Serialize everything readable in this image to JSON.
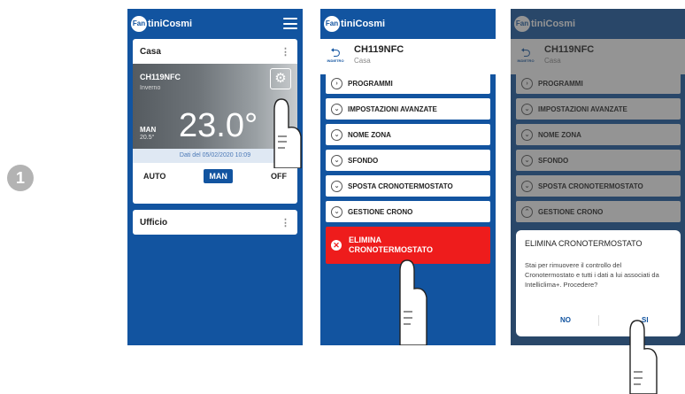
{
  "step_number": "1",
  "brand": {
    "circle": "Fan",
    "text": "tiniCosmi"
  },
  "screen1": {
    "zones": [
      {
        "label": "Casa"
      },
      {
        "label": "Ufficio"
      }
    ],
    "thermostat": {
      "name": "CH119NFC",
      "season": "Inverno",
      "mode": "MAN",
      "setpoint": "20.5°",
      "temperature": "23.0°"
    },
    "date_text": "Dati del 05/02/2020 10:09",
    "modes": [
      "AUTO",
      "MAN",
      "OFF"
    ],
    "selected_mode": "MAN"
  },
  "device_header": {
    "back_label": "INDIETRO",
    "device": "CH119NFC",
    "zone": "Casa"
  },
  "screen2": {
    "items": [
      "PROGRAMMI",
      "IMPOSTAZIONI AVANZATE",
      "NOME ZONA",
      "SFONDO",
      "SPOSTA CRONOTERMOSTATO",
      "GESTIONE CRONO"
    ],
    "delete": {
      "line1": "ELIMINA",
      "line2": "CRONOTERMOSTATO"
    }
  },
  "screen3": {
    "dialog": {
      "title": "ELIMINA CRONOTERMOSTATO",
      "body": "Stai per rimuovere il controllo del Cronotermostato e tutti i dati a lui associati da Intelliclima+. Procedere?",
      "no": "NO",
      "yes": "SI"
    }
  },
  "colors": {
    "brand_blue": "#1254a0",
    "danger_red": "#ee1c1c"
  }
}
